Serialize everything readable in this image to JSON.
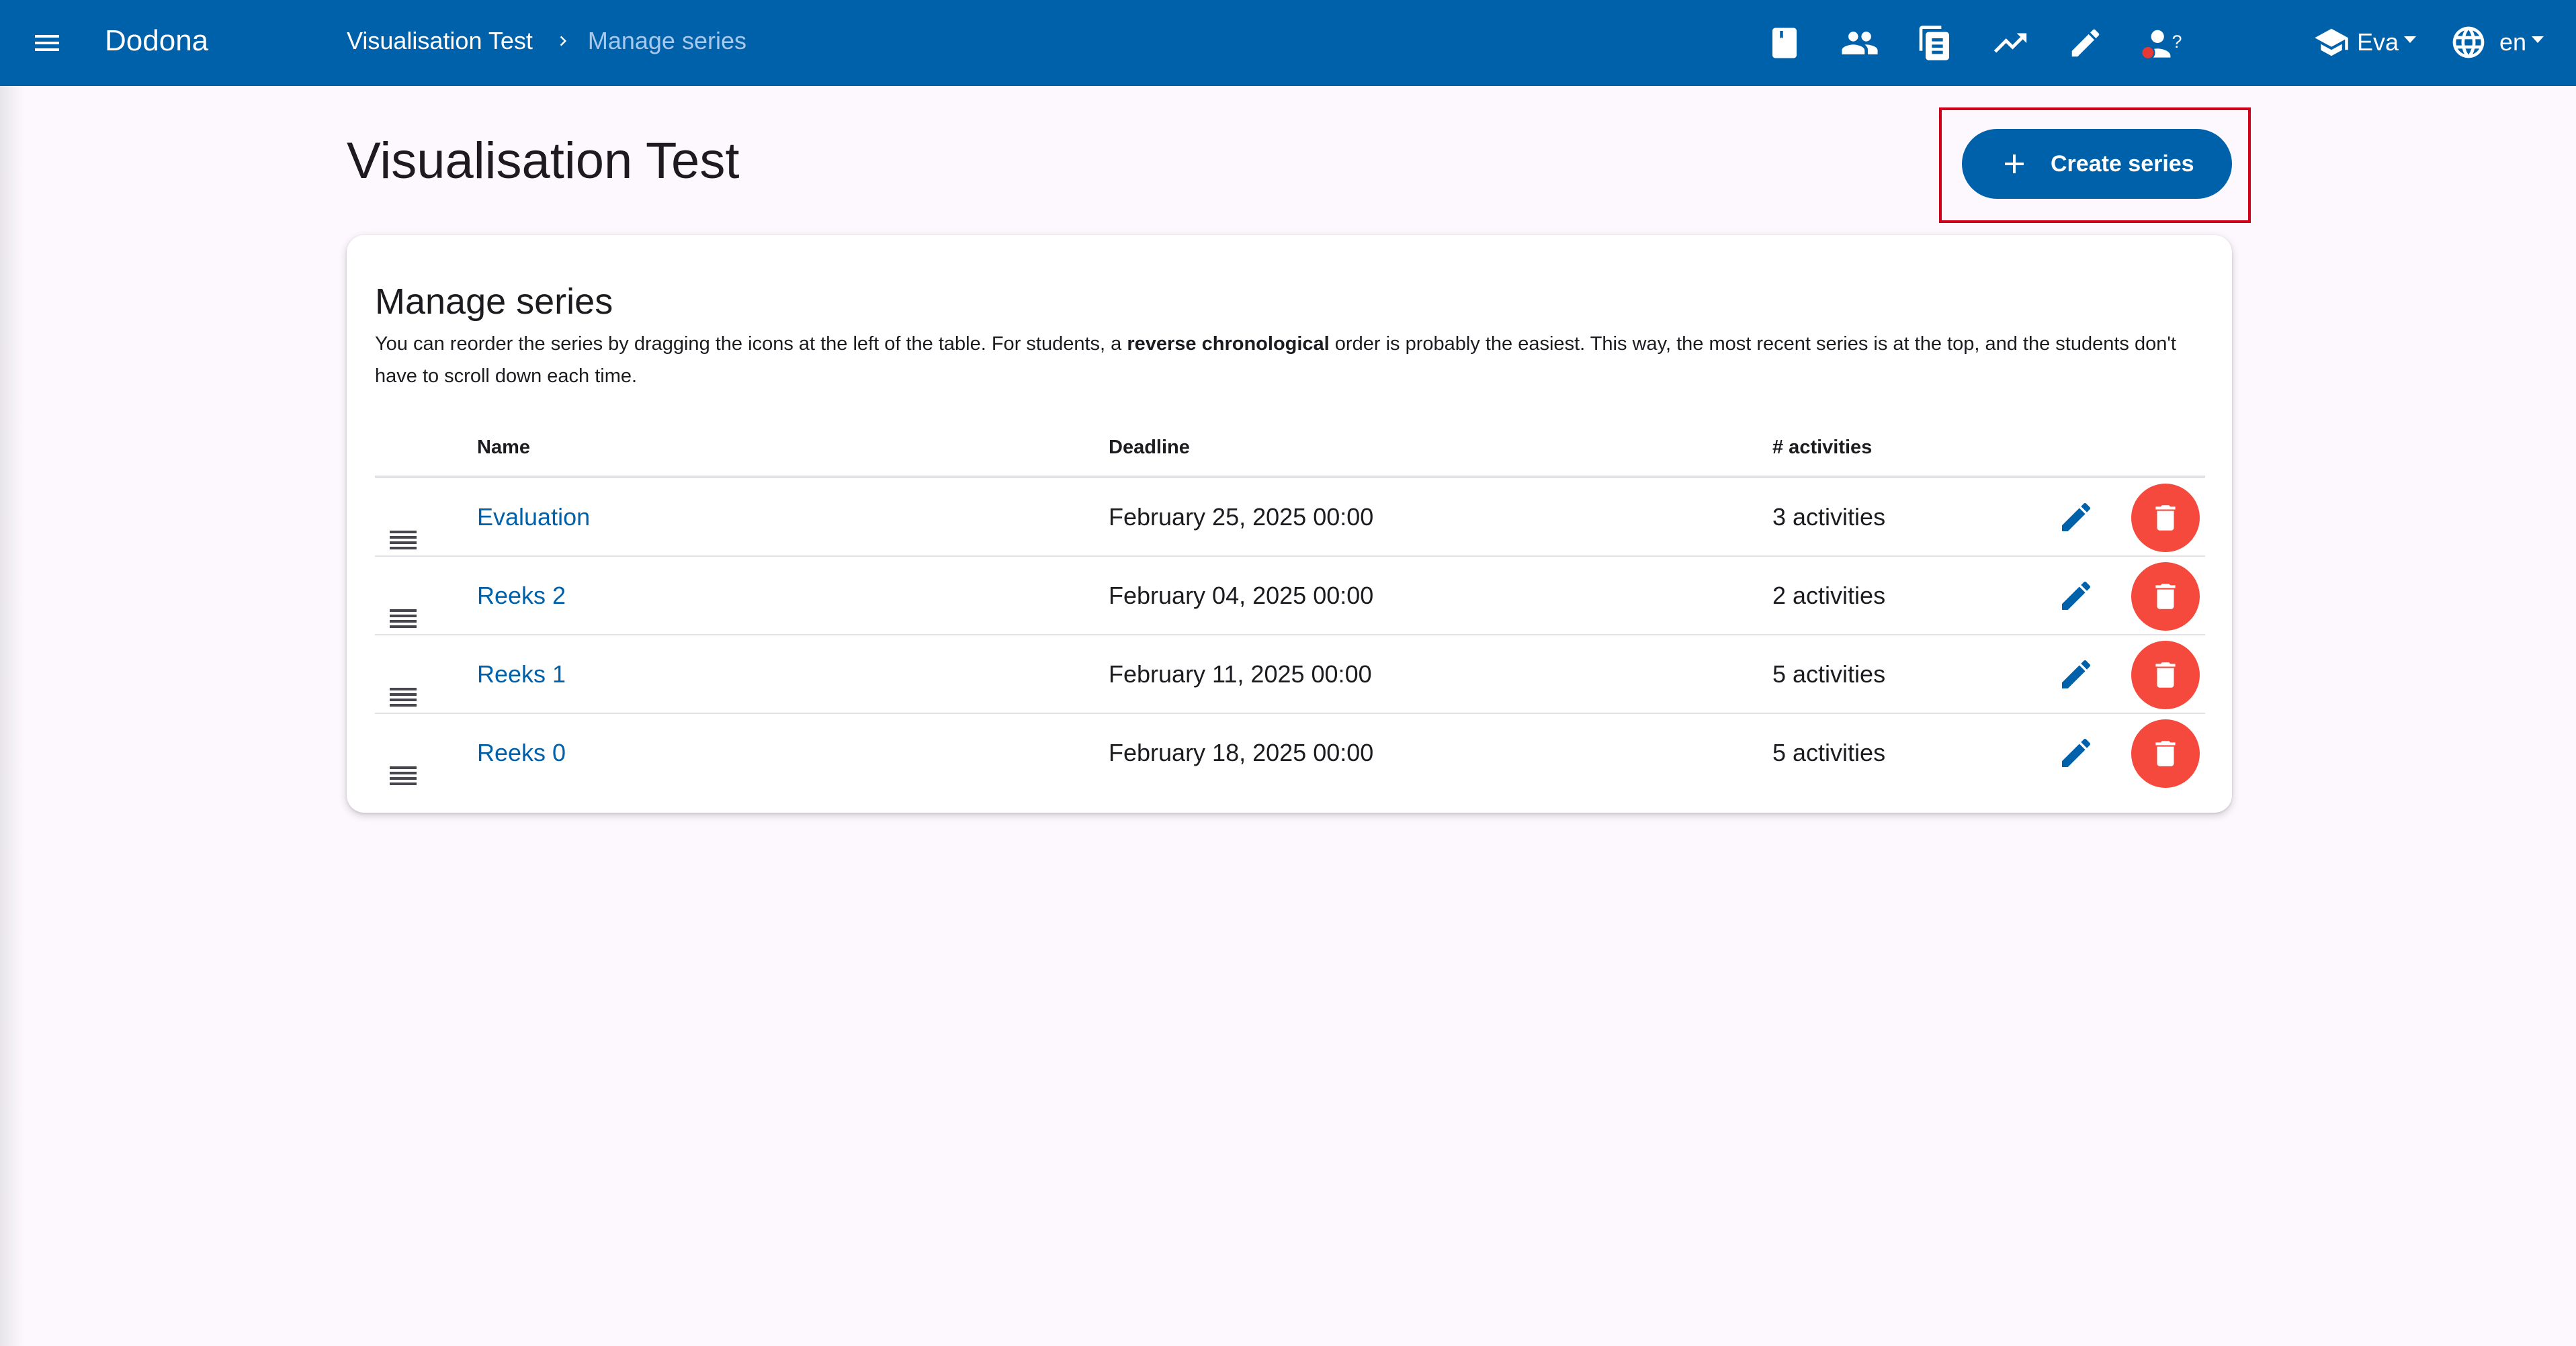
{
  "app": {
    "brand": "Dodona"
  },
  "breadcrumb": {
    "course": "Visualisation Test",
    "current": "Manage series"
  },
  "nav_icons": [
    "book-icon",
    "users-icon",
    "document-icon",
    "trending-up-icon",
    "pencil-icon",
    "user-question-icon"
  ],
  "user": {
    "name": "Eva"
  },
  "language": {
    "code": "en"
  },
  "page": {
    "title": "Visualisation Test",
    "create_label": "Create series"
  },
  "card": {
    "title": "Manage series",
    "desc_before": "You can reorder the series by dragging the icons at the left of the table. For students, a ",
    "desc_bold": "reverse chronological",
    "desc_after": " order is probably the easiest. This way, the most recent series is at the top, and the students don't have to scroll down each time."
  },
  "table": {
    "headers": {
      "name": "Name",
      "deadline": "Deadline",
      "activities": "# activities"
    },
    "rows": [
      {
        "name": "Evaluation",
        "deadline": "February 25, 2025 00:00",
        "activities": "3 activities"
      },
      {
        "name": "Reeks 2",
        "deadline": "February 04, 2025 00:00",
        "activities": "2 activities"
      },
      {
        "name": "Reeks 1",
        "deadline": "February 11, 2025 00:00",
        "activities": "5 activities"
      },
      {
        "name": "Reeks 0",
        "deadline": "February 18, 2025 00:00",
        "activities": "5 activities"
      }
    ]
  },
  "colors": {
    "primary": "#0061ab",
    "danger": "#f5493d",
    "highlight": "#d0021b",
    "background": "#fcf8fd"
  }
}
